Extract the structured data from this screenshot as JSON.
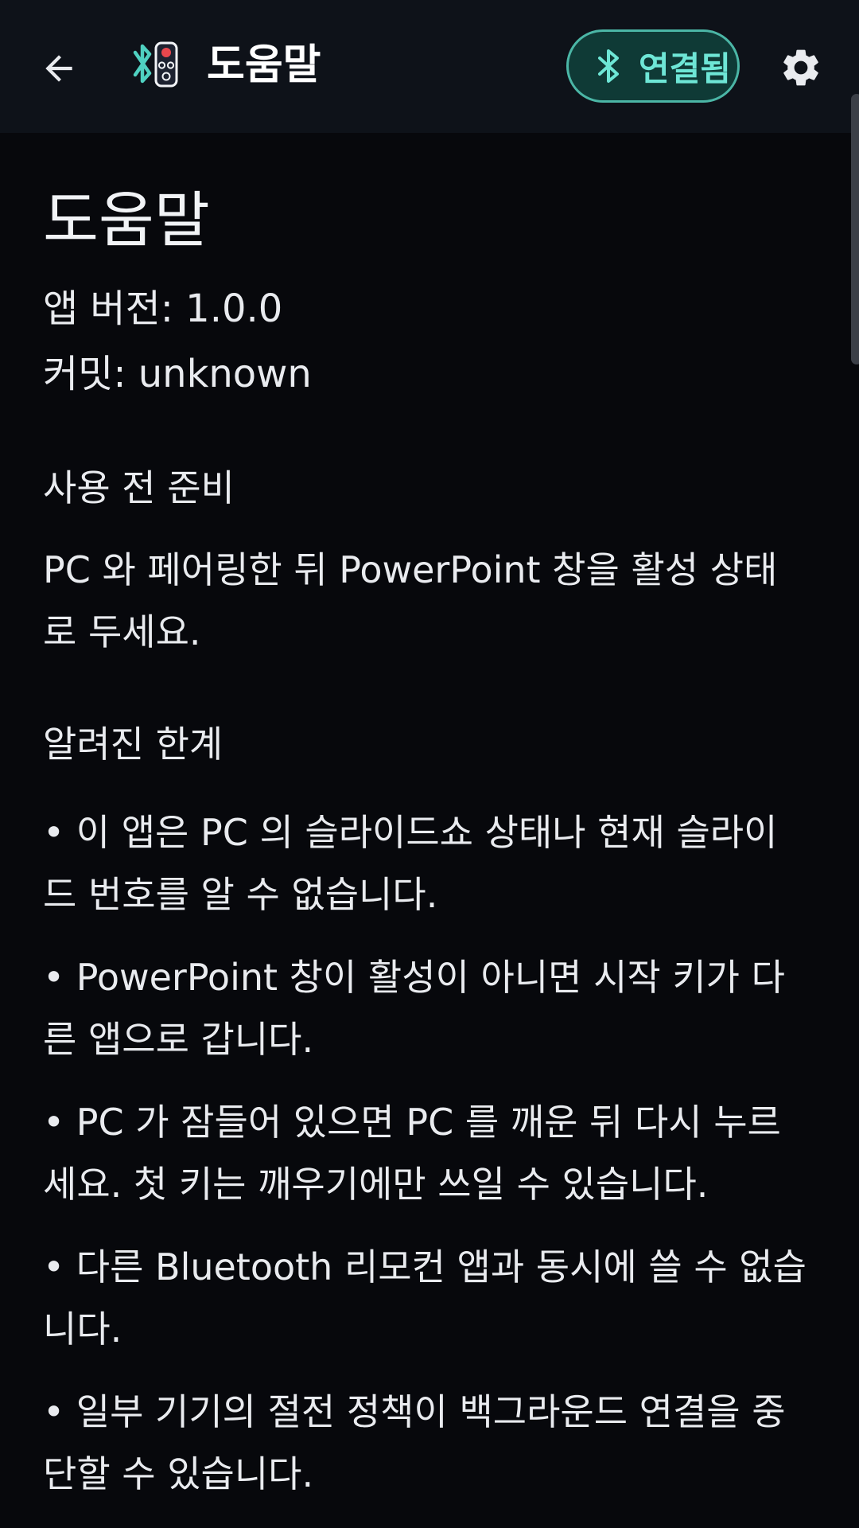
{
  "header": {
    "title": "도움말",
    "connection_label": "연결됨"
  },
  "colors": {
    "background": "#07080c",
    "topbar": "#0e1219",
    "accent": "#6ee6d6",
    "badge_border": "#4bb6a6",
    "badge_fill": "#0f3a36"
  },
  "icons": {
    "back": "arrow-left-icon",
    "logo": "remote-bluetooth-logo-icon",
    "bluetooth": "bluetooth-icon",
    "settings": "gear-icon"
  },
  "main": {
    "title": "도움말",
    "version_line": "앱 버전: 1.0.0",
    "commit_line": "커밋: unknown",
    "prep_heading": "사용 전 준비",
    "prep_body": "PC 와 페어링한 뒤 PowerPoint 창을 활성 상태로 두세요.",
    "limits_heading": "알려진 한계",
    "limits": [
      "• 이 앱은 PC 의 슬라이드쇼 상태나 현재 슬라이드 번호를 알 수 없습니다.",
      "• PowerPoint 창이 활성이 아니면 시작 키가 다른 앱으로 갑니다.",
      "• PC 가 잠들어 있으면 PC 를 깨운 뒤 다시 누르세요. 첫 키는 깨우기에만 쓰일 수 있습니다.",
      "• 다른 Bluetooth 리모컨 앱과 동시에 쓸 수 없습니다.",
      "• 일부 기기의 절전 정책이 백그라운드 연결을 중단할 수 있습니다."
    ]
  }
}
